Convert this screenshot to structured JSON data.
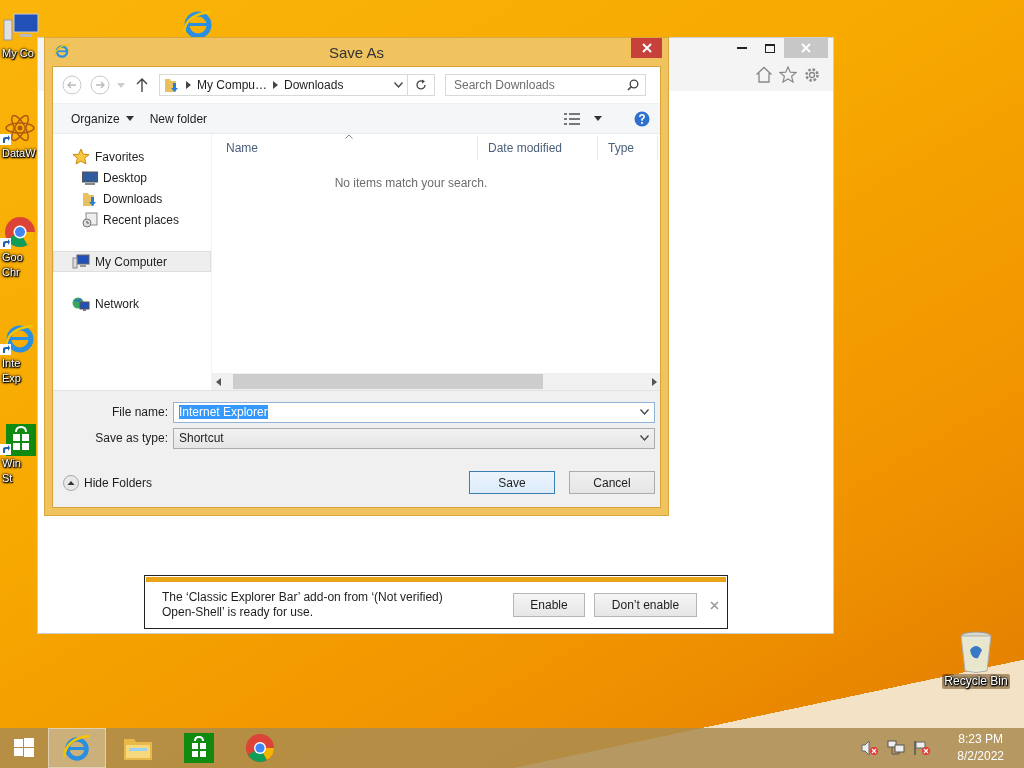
{
  "desktop_icons": [
    {
      "kind": "computer",
      "label_lines": [
        "My Co"
      ]
    },
    {
      "kind": "atom",
      "label_lines": [
        "DataW"
      ]
    },
    {
      "kind": "chrome",
      "label_lines": [
        "Goo",
        "Chr"
      ]
    },
    {
      "kind": "ie",
      "label_lines": [
        "Inte",
        "Exp"
      ]
    },
    {
      "kind": "store",
      "label_lines": [
        "Win",
        "St"
      ]
    }
  ],
  "recycle_bin": {
    "label": "Recycle Bin"
  },
  "dialog": {
    "title": "Save As",
    "breadcrumb": [
      "My Compu…",
      "Downloads"
    ],
    "search": {
      "placeholder": "Search Downloads"
    },
    "commands": [
      "Organize",
      "New folder"
    ],
    "nav": [
      {
        "kind": "star",
        "label": "Favorites",
        "selected": false,
        "children": [
          {
            "kind": "desktop",
            "label": "Desktop",
            "selected": false
          },
          {
            "kind": "downloads",
            "label": "Downloads",
            "selected": false
          },
          {
            "kind": "recent",
            "label": "Recent places",
            "selected": false
          }
        ]
      },
      {
        "kind": "computer",
        "label": "My Computer",
        "selected": true
      },
      {
        "kind": "network",
        "label": "Network",
        "selected": false
      }
    ],
    "columns": [
      "Name",
      "Date modified",
      "Type"
    ],
    "empty_message": "No items match your search.",
    "file_name": {
      "label": "File name:",
      "value": "Internet Explorer",
      "text_selected": true
    },
    "save_as_type": {
      "label": "Save as type:",
      "value": "Shortcut"
    },
    "hide_folders": "Hide Folders",
    "buttons": [
      "Save",
      "Cancel"
    ]
  },
  "notification": {
    "text": "The ‘Classic Explorer Bar’ add-on from ‘(Not verified) Open-Shell’ is ready for use.",
    "buttons": [
      "Enable",
      "Don’t enable"
    ]
  },
  "taskbar": {
    "apps": [
      {
        "kind": "ie",
        "active": true
      },
      {
        "kind": "explorer",
        "active": false
      },
      {
        "kind": "store",
        "active": false
      },
      {
        "kind": "chrome",
        "active": false
      }
    ],
    "clock": {
      "time": "8:23 PM",
      "date": "8/2/2022"
    }
  }
}
